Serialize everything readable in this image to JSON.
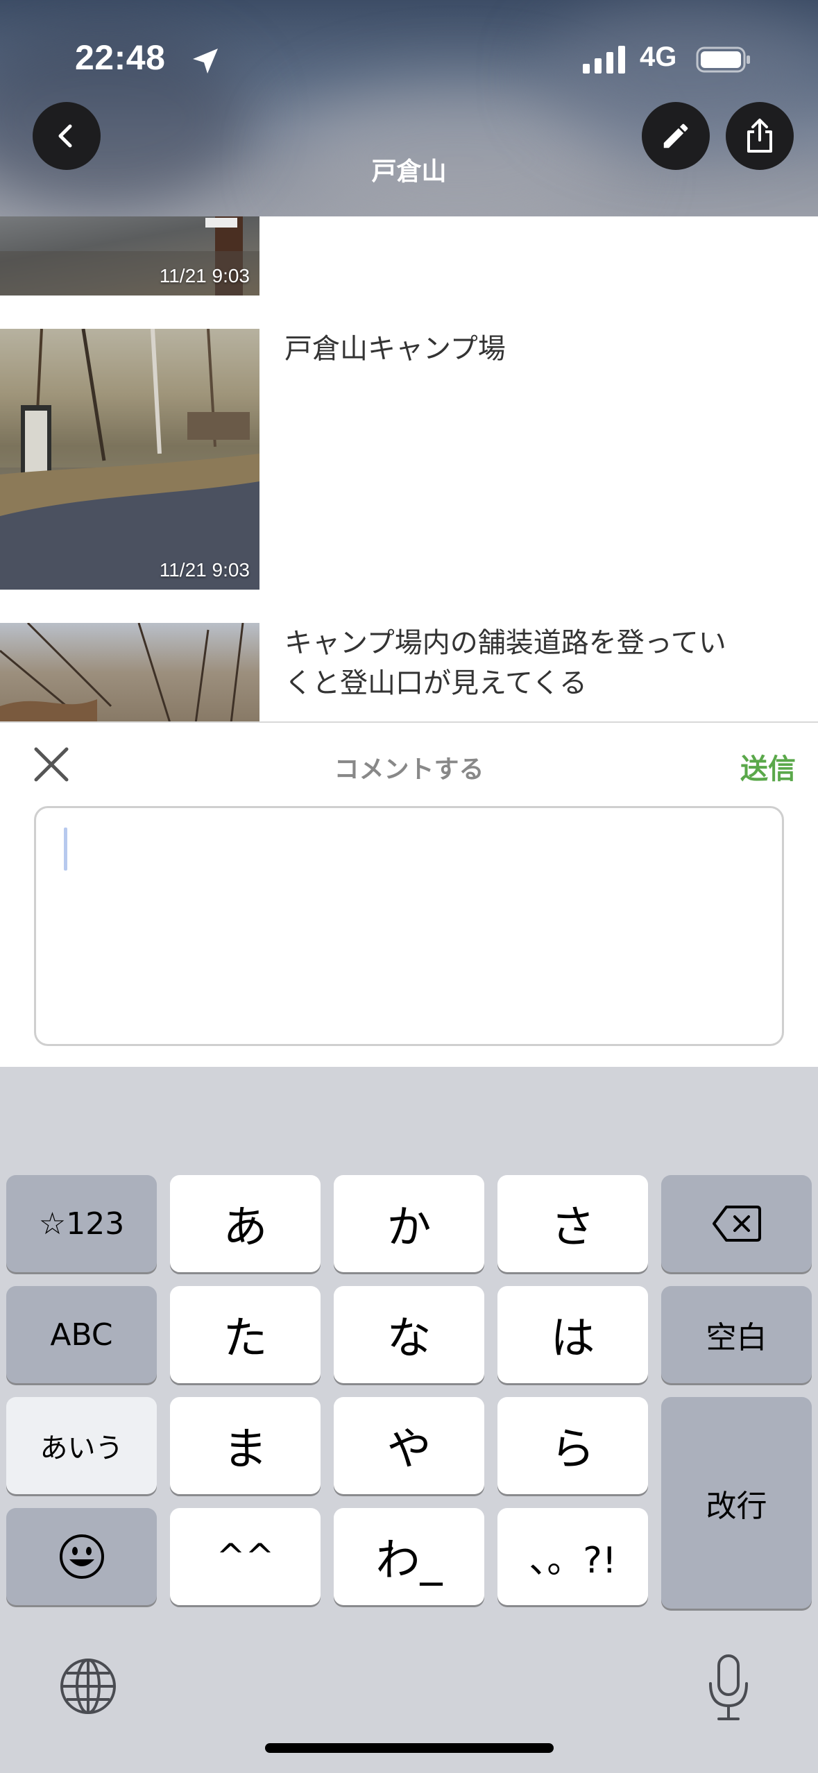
{
  "status_bar": {
    "time": "22:48",
    "network": "4G",
    "icons": [
      "location-arrow-icon",
      "signal-icon",
      "battery-icon"
    ]
  },
  "header": {
    "title": "戸倉山",
    "buttons": [
      "back-icon",
      "pencil-icon",
      "share-icon"
    ]
  },
  "feed": {
    "items": [
      {
        "timestamp": "11/21 9:03",
        "caption": ""
      },
      {
        "timestamp": "11/21 9:03",
        "caption": "戸倉山キャンプ場"
      },
      {
        "timestamp": "",
        "caption_lines": [
          "キャンプ場内の舗装道路を登ってい",
          "くと登山口が見えてくる"
        ]
      }
    ]
  },
  "comment": {
    "title": "コメントする",
    "send_label": "送信",
    "input_value": ""
  },
  "keyboard": {
    "rows": [
      [
        "☆123",
        "あ",
        "か",
        "さ",
        "delete-icon"
      ],
      [
        "ABC",
        "た",
        "な",
        "は",
        "空白"
      ],
      [
        "あいう",
        "ま",
        "や",
        "ら",
        "改行"
      ],
      [
        "emoji-icon",
        "^^",
        "わ_",
        "、。?!"
      ]
    ],
    "bottom_icons": [
      "globe-icon",
      "microphone-icon"
    ]
  },
  "colors": {
    "accent_green": "#5aa84a",
    "keyboard_bg": "#d1d3d9",
    "key_gray": "#abb0bc"
  }
}
